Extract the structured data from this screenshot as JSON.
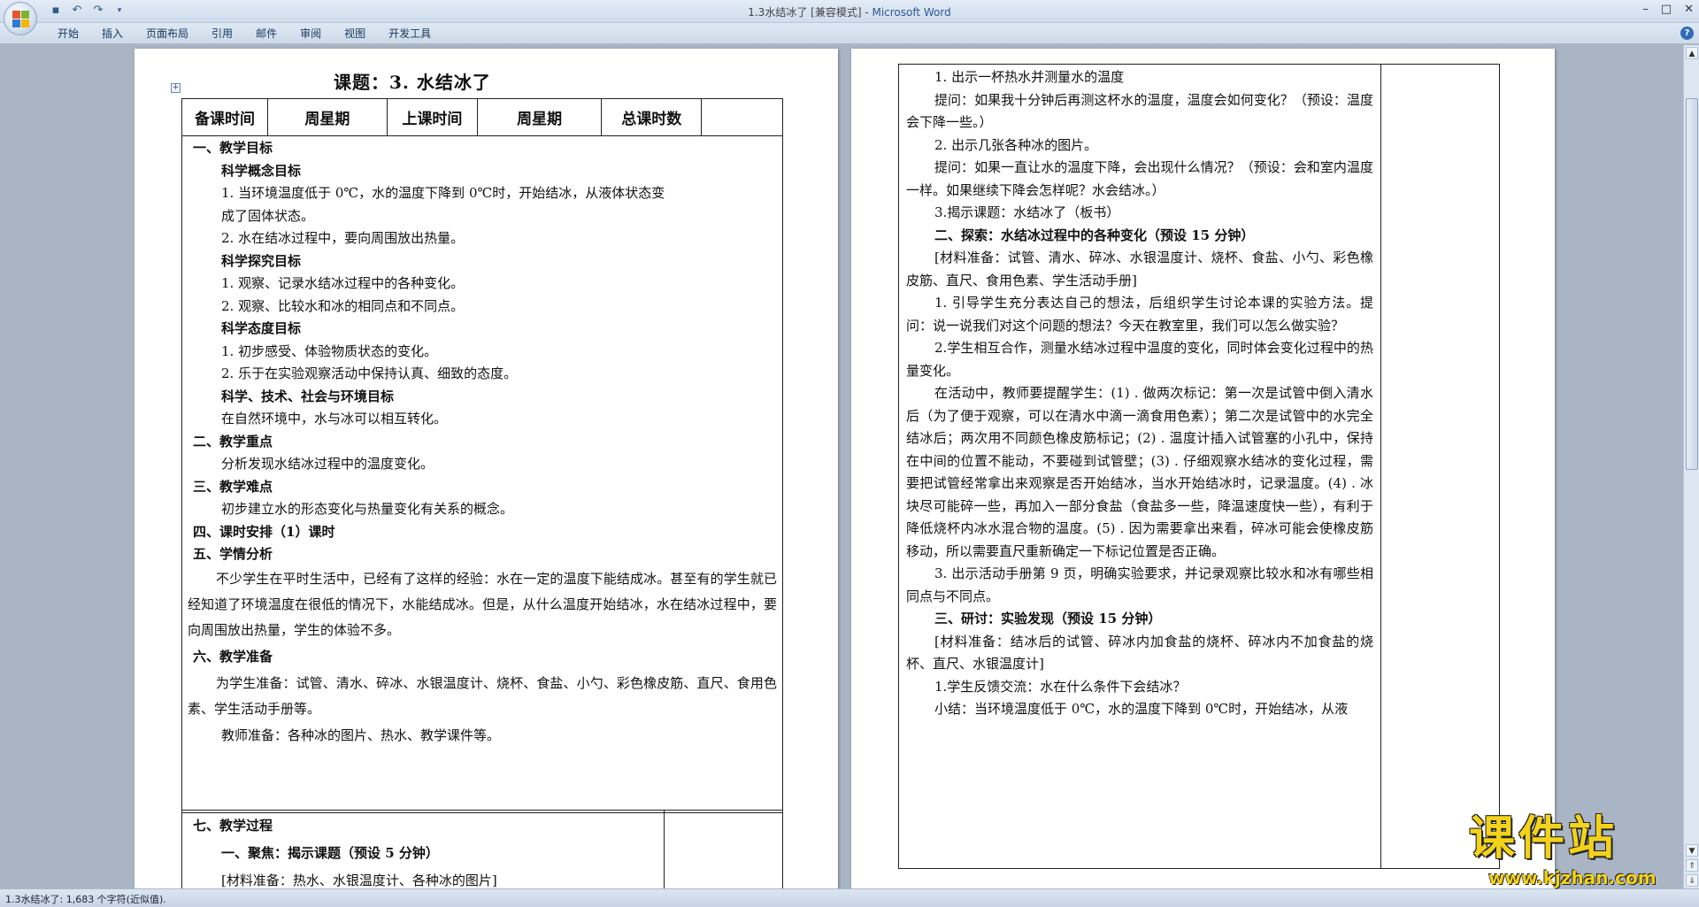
{
  "window": {
    "title_doc": "1.3水结冰了 [兼容模式]",
    "title_sep": " - ",
    "title_app": "Microsoft Word",
    "controls": [
      "–",
      "□",
      "✕"
    ]
  },
  "quick_access": [
    "save-icon",
    "undo-icon",
    "redo-icon",
    "customize-icon"
  ],
  "ribbon": {
    "tabs": [
      "开始",
      "插入",
      "页面布局",
      "引用",
      "邮件",
      "审阅",
      "视图",
      "开发工具"
    ],
    "help": "?"
  },
  "left_page": {
    "title": "课题：3. 水结冰了",
    "table_headers": [
      "备课时间",
      "周星期",
      "上课时间",
      "周星期",
      "总课时数",
      ""
    ],
    "lines": [
      {
        "text": "一、教学目标",
        "bold": true,
        "indent": 0
      },
      {
        "text": "科学概念目标",
        "bold": true,
        "indent": 1
      },
      {
        "text": "1. 当环境温度低于 0℃，水的温度下降到 0℃时，开始结冰，从液体状态变",
        "bold": false,
        "indent": 1
      },
      {
        "text": "成了固体状态。",
        "bold": false,
        "indent": 1
      },
      {
        "text": "2. 水在结冰过程中，要向周围放出热量。",
        "bold": false,
        "indent": 1
      },
      {
        "text": "科学探究目标",
        "bold": true,
        "indent": 1
      },
      {
        "text": "1. 观察、记录水结冰过程中的各种变化。",
        "bold": false,
        "indent": 1
      },
      {
        "text": "2. 观察、比较水和冰的相同点和不同点。",
        "bold": false,
        "indent": 1
      },
      {
        "text": "科学态度目标",
        "bold": true,
        "indent": 1
      },
      {
        "text": "1. 初步感受、体验物质状态的变化。",
        "bold": false,
        "indent": 1
      },
      {
        "text": "2. 乐于在实验观察活动中保持认真、细致的态度。",
        "bold": false,
        "indent": 1
      },
      {
        "text": "科学、技术、社会与环境目标",
        "bold": true,
        "indent": 1
      },
      {
        "text": "在自然环境中，水与冰可以相互转化。",
        "bold": false,
        "indent": 1
      },
      {
        "text": "二、教学重点",
        "bold": true,
        "indent": 0
      },
      {
        "text": "分析发现水结冰过程中的温度变化。",
        "bold": false,
        "indent": 1
      },
      {
        "text": "三、教学难点",
        "bold": true,
        "indent": 0
      },
      {
        "text": "初步建立水的形态变化与热量变化有关系的概念。",
        "bold": false,
        "indent": 1
      },
      {
        "text": "四、课时安排（1）课时",
        "bold": true,
        "indent": 0
      },
      {
        "text": "五、学情分析",
        "bold": true,
        "indent": 0
      }
    ],
    "analysis": "不少学生在平时生活中，已经有了这样的经验：水在一定的温度下能结成冰。甚至有的学生就已经知道了环境温度在很低的情况下，水能结成冰。但是，从什么温度开始结冰，水在结冰过程中，要向周围放出热量，学生的体验不多。",
    "prep_heading": "六、教学准备",
    "student_prep": "为学生准备：试管、清水、碎冰、水银温度计、烧杯、食盐、小勺、彩色橡皮筋、直尺、食用色素、学生活动手册等。",
    "teacher_prep": "教师准备：各种冰的图片、热水、教学课件等。",
    "process_heading": "七、教学过程",
    "process_sub": "一、聚焦：揭示课题（预设 5 分钟）",
    "process_materials": "[材料准备：热水、水银温度计、各种冰的图片]"
  },
  "right_page": {
    "blocks": [
      {
        "text": "1. 出示一杯热水并测量水的温度",
        "bold": false,
        "type": "line"
      },
      {
        "text": "提问：如果我十分钟后再测这杯水的温度，温度会如何变化？（预设：温度会下降一些。）",
        "bold": false,
        "type": "para"
      },
      {
        "text": "2. 出示几张各种冰的图片。",
        "bold": false,
        "type": "line"
      },
      {
        "text": "提问：如果一直让水的温度下降，会出现什么情况？（预设：会和室内温度一样。如果继续下降会怎样呢？水会结冰。）",
        "bold": false,
        "type": "para"
      },
      {
        "text": "3.揭示课题：水结冰了（板书）",
        "bold": false,
        "type": "line"
      },
      {
        "text": "二、探索：水结冰过程中的各种变化（预设 15 分钟）",
        "bold": true,
        "type": "line"
      },
      {
        "text": "[材料准备：试管、清水、碎冰、水银温度计、烧杯、食盐、小勺、彩色橡皮筋、直尺、食用色素、学生活动手册]",
        "bold": false,
        "type": "para"
      },
      {
        "text": "1. 引导学生充分表达自己的想法，后组织学生讨论本课的实验方法。提问：说一说我们对这个问题的想法？今天在教室里，我们可以怎么做实验？",
        "bold": false,
        "type": "para"
      },
      {
        "text": "2.学生相互合作，测量水结冰过程中温度的变化，同时体会变化过程中的热量变化。",
        "bold": false,
        "type": "para"
      },
      {
        "text": "在活动中，教师要提醒学生：(1) . 做两次标记：第一次是试管中倒入清水后（为了便于观察，可以在清水中滴一滴食用色素）；第二次是试管中的水完全结冰后；两次用不同颜色橡皮筋标记；(2) . 温度计插入试管塞的小孔中，保持在中间的位置不能动，不要碰到试管壁；(3) . 仔细观察水结冰的变化过程，需要把试管经常拿出来观察是否开始结冰，当水开始结冰时，记录温度。(4) . 冰块尽可能碎一些，再加入一部分食盐（食盐多一些，降温速度快一些），有利于降低烧杯内冰水混合物的温度。(5) . 因为需要拿出来看，碎冰可能会使橡皮筋移动，所以需要直尺重新确定一下标记位置是否正确。",
        "bold": false,
        "type": "para"
      },
      {
        "text": "3. 出示活动手册第 9 页，明确实验要求，并记录观察比较水和冰有哪些相同点与不同点。",
        "bold": false,
        "type": "para"
      },
      {
        "text": "三、研讨：实验发现（预设 15 分钟）",
        "bold": true,
        "type": "line"
      },
      {
        "text": "[材料准备：结冰后的试管、碎冰内加食盐的烧杯、碎冰内不加食盐的烧杯、直尺、水银温度计]",
        "bold": false,
        "type": "para"
      },
      {
        "text": "1.学生反馈交流：水在什么条件下会结冰？",
        "bold": false,
        "type": "line"
      },
      {
        "text": "小结：当环境温度低于 0℃，水的温度下降到 0℃时，开始结冰，从液",
        "bold": false,
        "type": "line"
      }
    ]
  },
  "status": {
    "text": "1.3水结冰了: 1,683 个字符(近似值)."
  },
  "watermark": {
    "text": "课件站",
    "url": "www.kjzhan.com"
  },
  "colors": {
    "accent": "#2b5797",
    "watermark": "#f3d21a"
  }
}
